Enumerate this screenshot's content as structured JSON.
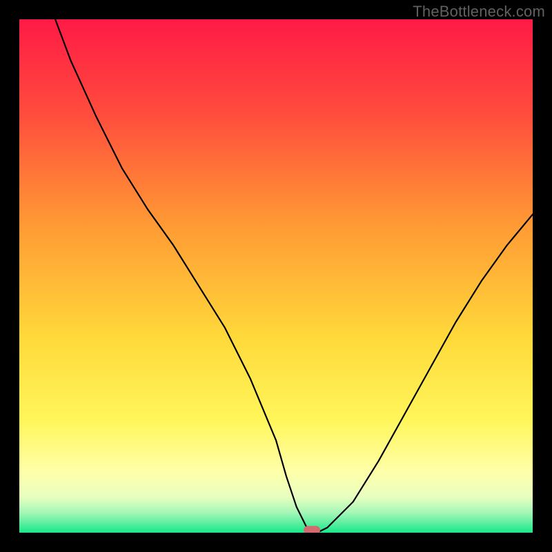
{
  "watermark": "TheBottleneck.com",
  "colors": {
    "gradient_top": "#ff1a46",
    "gradient_mid1": "#ff7b34",
    "gradient_mid2": "#ffd93a",
    "gradient_pale": "#ffffa8",
    "gradient_bottom": "#19e88b",
    "curve": "#000000",
    "marker": "#d26a6e",
    "frame": "#000000",
    "watermark_text": "#616161"
  },
  "chart_data": {
    "type": "line",
    "title": "",
    "xlabel": "",
    "ylabel": "",
    "xlim": [
      0,
      100
    ],
    "ylim": [
      0,
      100
    ],
    "grid": false,
    "legend": false,
    "series": [
      {
        "name": "bottleneck-curve",
        "x": [
          7,
          10,
          15,
          20,
          25,
          30,
          35,
          40,
          45,
          50,
          52,
          54,
          56,
          58,
          60,
          65,
          70,
          75,
          80,
          85,
          90,
          95,
          100
        ],
        "y": [
          100,
          92,
          81,
          71,
          63,
          56,
          48,
          40,
          30,
          18,
          11,
          5,
          1,
          0,
          1,
          6,
          14,
          23,
          32,
          41,
          49,
          56,
          62
        ]
      }
    ],
    "annotations": [
      {
        "name": "minimum-marker",
        "shape": "pill",
        "x": 57,
        "y": 0.5,
        "color": "#d26a6e"
      }
    ]
  }
}
